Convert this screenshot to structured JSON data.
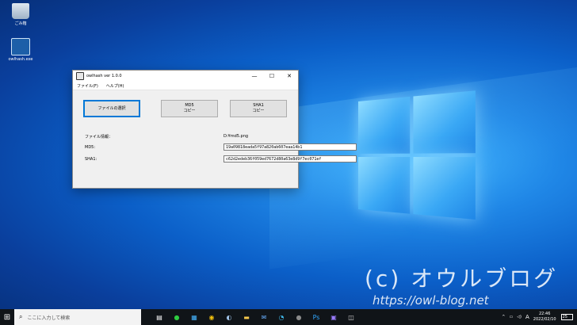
{
  "desktop": {
    "icons": [
      {
        "label": "ごみ箱",
        "icon": "recycle-bin-icon"
      },
      {
        "label": "owlhash.exe",
        "icon": "app-icon"
      }
    ]
  },
  "window": {
    "title": "owlhash ver 1.0.0",
    "controls": {
      "minimize": "—",
      "maximize": "☐",
      "close": "✕"
    },
    "menu": [
      "ファイル(F)",
      "ヘルプ(H)"
    ],
    "buttons": {
      "select_file": "ファイルの選択",
      "md5_line1": "MD5",
      "md5_line2": "コピー",
      "sha1_line1": "SHA1",
      "sha1_line2": "コピー"
    },
    "file_info_label": "ファイル情報：",
    "file_info_value": "D:¥md5.png",
    "md5_label": "MD5:",
    "md5_value": "19a09818eada5f97a820ab607eaa14b1",
    "sha1_label": "SHA1:",
    "sha1_value": "c62d2edeb36f059ed7672d80a63e8d9f7ec071ef"
  },
  "taskbar": {
    "search_placeholder": "ここに入力して検索",
    "ime": "A",
    "time": "22:46",
    "date": "2022/02/10",
    "notification_count": "25"
  },
  "watermark": {
    "line1": "(c) オウルブログ",
    "line2": "https://owl-blog.net"
  }
}
